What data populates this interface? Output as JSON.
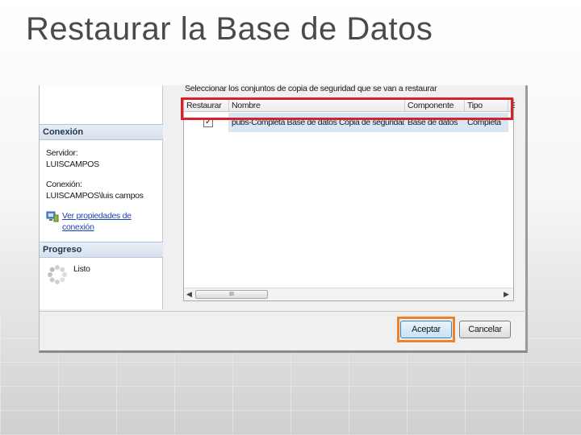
{
  "slide": {
    "title": "Restaurar la Base de Datos"
  },
  "dialog": {
    "select_label": "Seleccionar los conjuntos de copia de seguridad que se van a restaurar",
    "connection": {
      "header": "Conexión",
      "server_label": "Servidor:",
      "server_value": "LUISCAMPOS",
      "connection_label": "Conexión:",
      "connection_value": "LUISCAMPOS\\luis campos",
      "link_line1": "Ver propiedades de",
      "link_line2": "conexión",
      "icon": "connection-properties-icon"
    },
    "progress": {
      "header": "Progreso",
      "status": "Listo",
      "icon": "progress-spinner-icon"
    },
    "grid": {
      "columns": [
        "Restaurar",
        "Nombre",
        "Componente",
        "Tipo",
        "S"
      ],
      "rows": [
        {
          "restore_checked": true,
          "checkmark": "✓",
          "name": "pubs-Completa Base de datos Copia de seguridad",
          "component": "Base de datos",
          "type": "Completa"
        }
      ],
      "scroll_thumb": "III"
    },
    "buttons": {
      "ok": "Aceptar",
      "cancel": "Cancelar"
    }
  },
  "colors": {
    "highlight_row": "#d8212a",
    "highlight_button": "#e8842c",
    "title_text": "#4a4a4a"
  }
}
